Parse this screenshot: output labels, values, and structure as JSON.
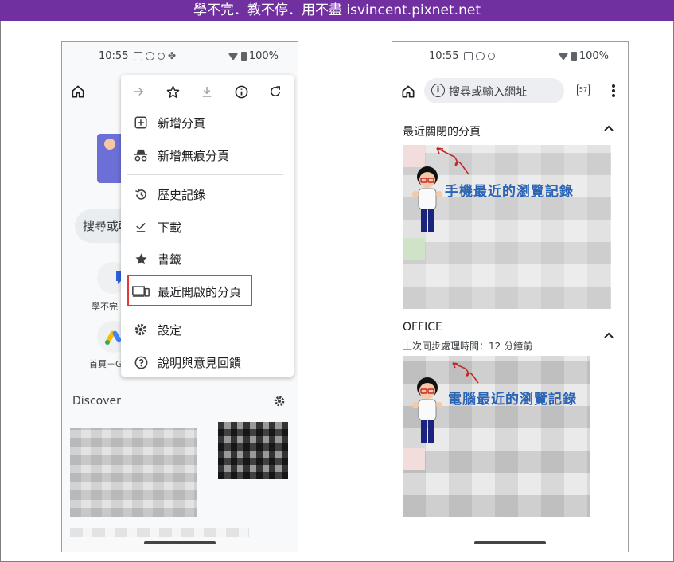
{
  "banner": {
    "text": "學不完．教不停．用不盡 isvincent.pixnet.net"
  },
  "colors": {
    "banner": "#7030a0",
    "highlight": "#e53935",
    "annotation": "#2b63b5"
  },
  "left_phone": {
    "status": {
      "time": "10:55",
      "battery": "100%"
    },
    "search_partial": "搜尋或輸",
    "shortcuts": [
      {
        "label": "學不完",
        "icon": "chat-bubble-icon"
      },
      {
        "label": "首頁－G",
        "icon": "google-ads-icon"
      }
    ],
    "discover": "Discover",
    "menu": {
      "toolbar": [
        "forward-icon",
        "star-icon",
        "download-icon",
        "info-icon",
        "refresh-icon"
      ],
      "items": [
        {
          "label": "新增分頁",
          "icon": "plus-square-icon"
        },
        {
          "label": "新增無痕分頁",
          "icon": "incognito-icon"
        },
        {
          "label": "歷史記錄",
          "icon": "history-icon"
        },
        {
          "label": "下載",
          "icon": "download-done-icon"
        },
        {
          "label": "書籤",
          "icon": "star-filled-icon"
        },
        {
          "label": "最近開啟的分頁",
          "icon": "devices-icon"
        },
        {
          "label": "設定",
          "icon": "gear-icon"
        },
        {
          "label": "說明與意見回饋",
          "icon": "help-icon"
        }
      ]
    }
  },
  "right_phone": {
    "status": {
      "time": "10:55",
      "battery": "100%"
    },
    "omnibox_placeholder": "搜尋或輸入網址",
    "tab_count": "57",
    "sections": [
      {
        "title": "最近關閉的分頁",
        "annotation": "手機最近的瀏覽記錄"
      },
      {
        "title": "OFFICE",
        "subtitle": "上次同步處理時間：12 分鐘前",
        "annotation": "電腦最近的瀏覽記錄"
      }
    ]
  }
}
